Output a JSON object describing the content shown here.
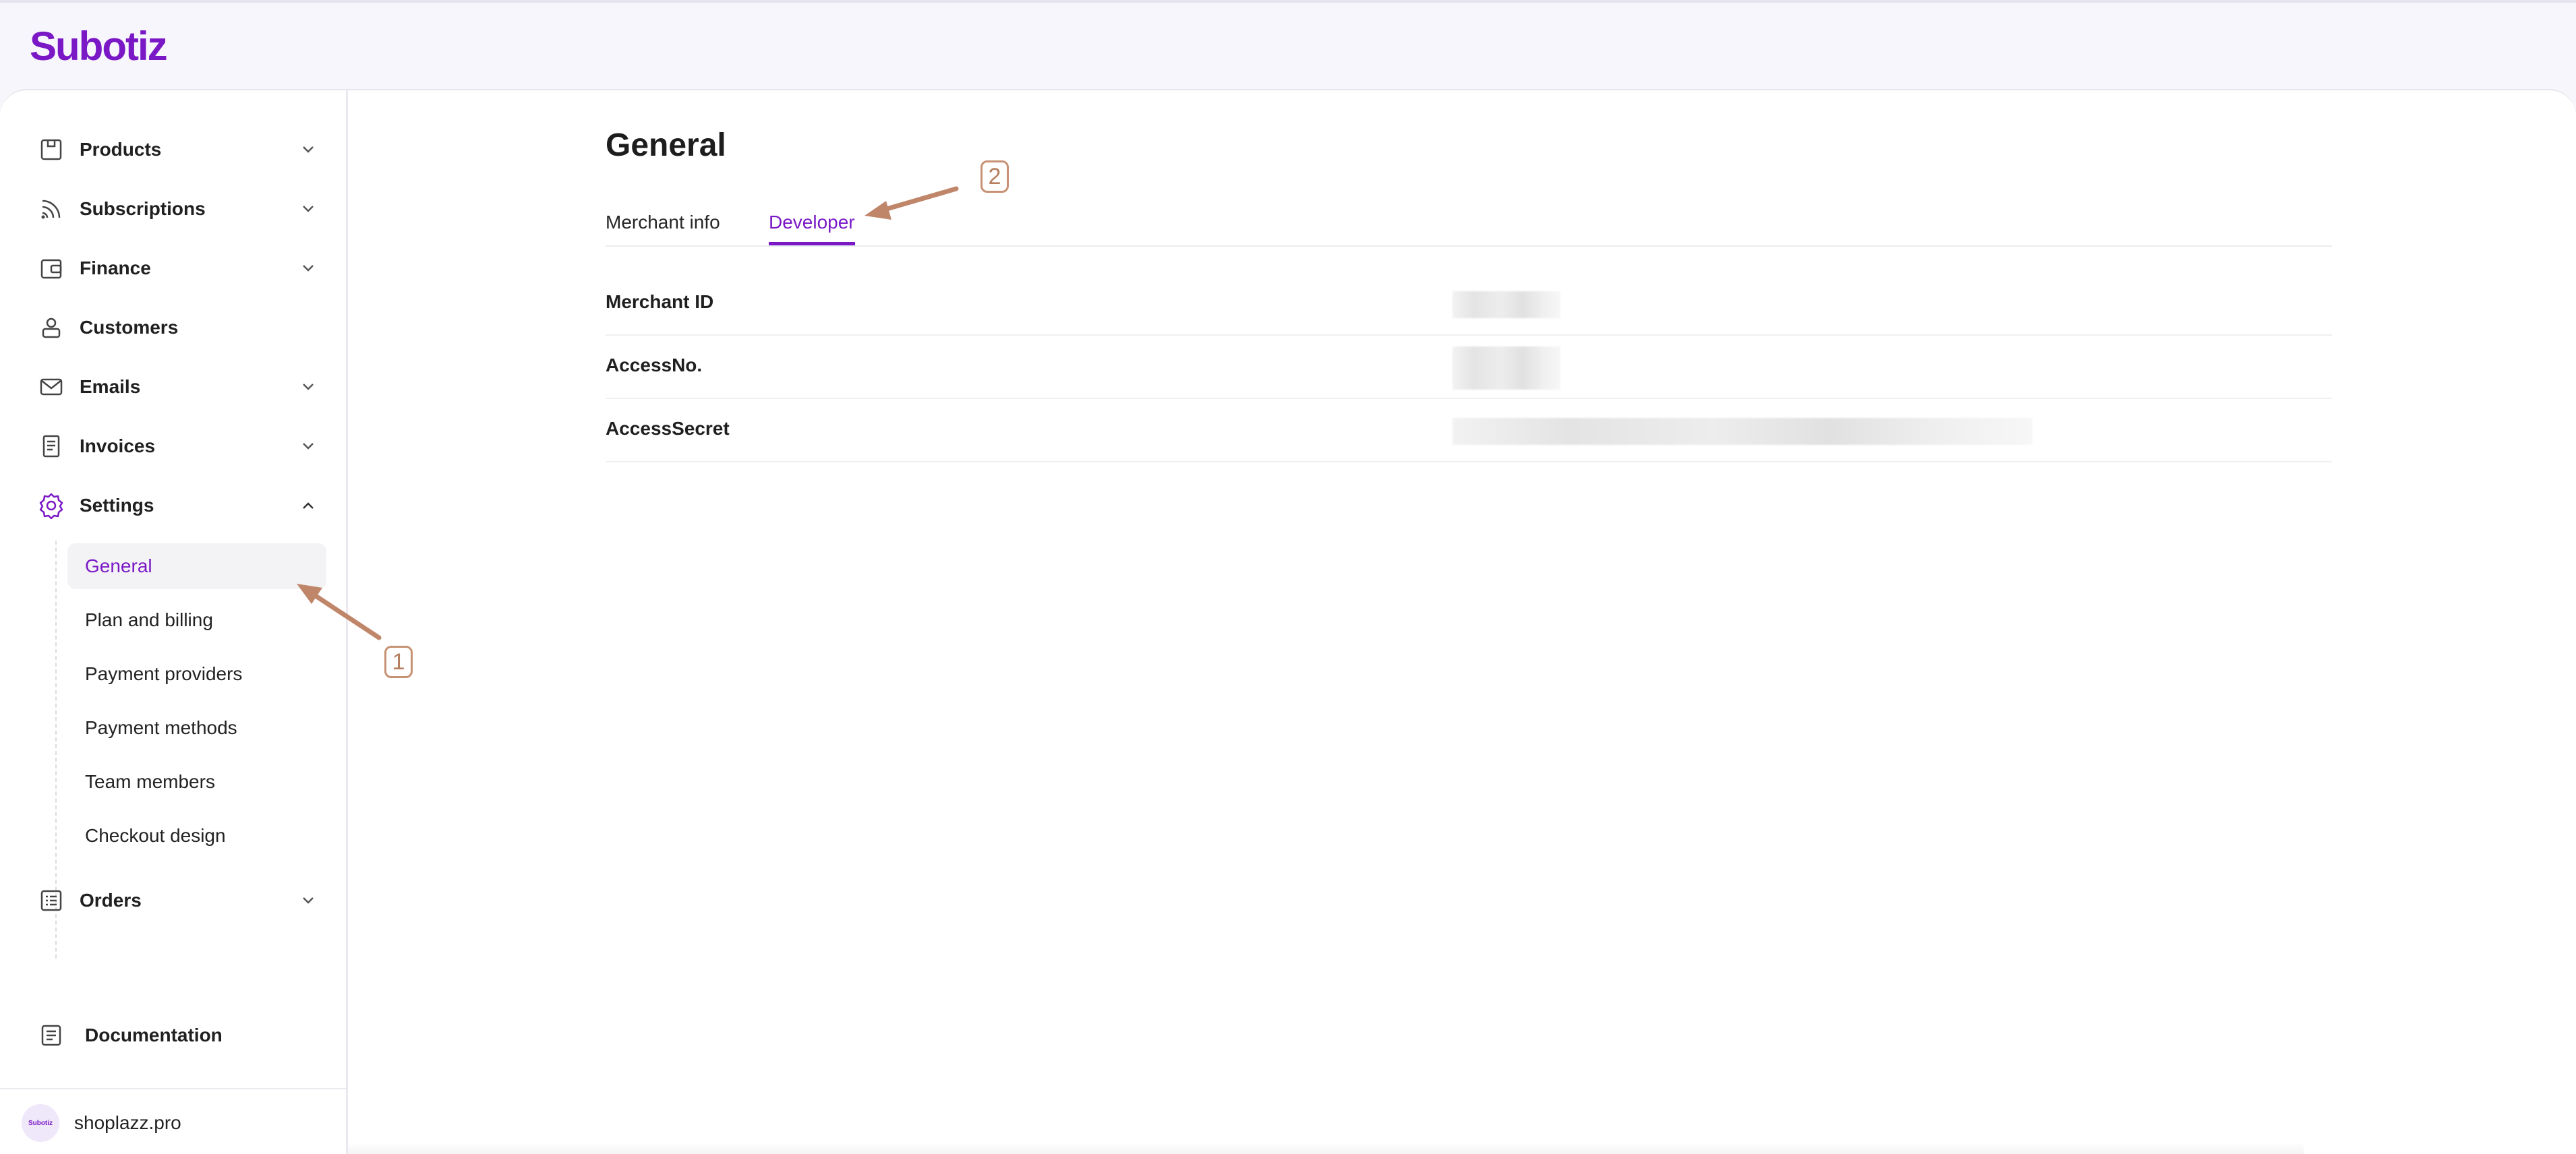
{
  "app": {
    "logo": "Subotiz",
    "accent_color": "#7a18c6"
  },
  "sidebar": {
    "items": [
      {
        "label": "Products",
        "icon": "box-icon",
        "has_chevron": true
      },
      {
        "label": "Subscriptions",
        "icon": "rss-icon",
        "has_chevron": true
      },
      {
        "label": "Finance",
        "icon": "wallet-icon",
        "has_chevron": true
      },
      {
        "label": "Customers",
        "icon": "user-icon",
        "has_chevron": false
      },
      {
        "label": "Emails",
        "icon": "mail-icon",
        "has_chevron": true
      },
      {
        "label": "Invoices",
        "icon": "receipt-icon",
        "has_chevron": true
      },
      {
        "label": "Settings",
        "icon": "gear-icon",
        "has_chevron": true,
        "expanded": true
      },
      {
        "label": "Orders",
        "icon": "list-icon",
        "has_chevron": true
      }
    ],
    "settings_sub": [
      {
        "label": "General",
        "active": true
      },
      {
        "label": "Plan and billing"
      },
      {
        "label": "Payment providers"
      },
      {
        "label": "Payment methods"
      },
      {
        "label": "Team members"
      },
      {
        "label": "Checkout design"
      }
    ],
    "documentation": "Documentation",
    "footer": {
      "avatar_text": "Subotiz",
      "store": "shoplazz.pro"
    }
  },
  "main": {
    "title": "General",
    "tabs": [
      {
        "label": "Merchant info",
        "active": false
      },
      {
        "label": "Developer",
        "active": true
      }
    ],
    "rows": [
      {
        "label": "Merchant ID"
      },
      {
        "label": "AccessNo."
      },
      {
        "label": "AccessSecret"
      }
    ]
  },
  "annotations": [
    {
      "number": "1",
      "target": "General"
    },
    {
      "number": "2",
      "target": "Developer"
    }
  ]
}
